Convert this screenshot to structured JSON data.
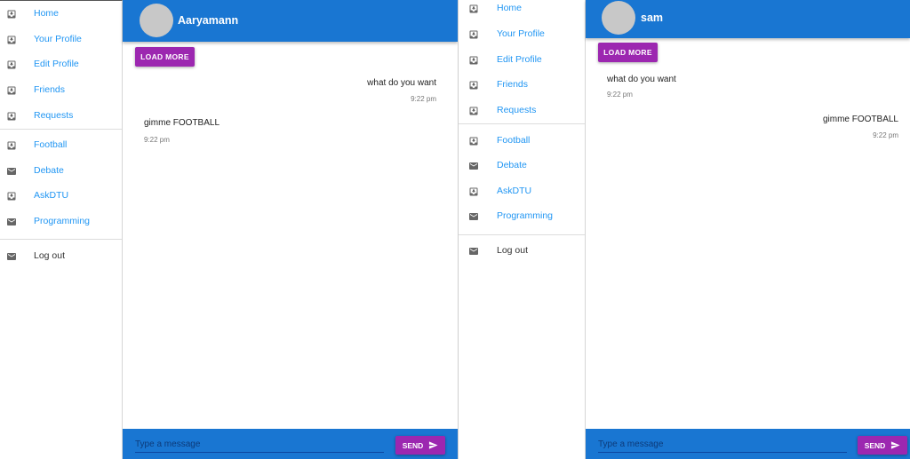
{
  "colors": {
    "appbar": "#1976d2",
    "accent": "#9c27b0",
    "link": "#2196f3",
    "avatar": "#c8c8c8"
  },
  "left": {
    "nav": {
      "items": [
        {
          "label": "Home",
          "icon": "inbox-icon"
        },
        {
          "label": "Your Profile",
          "icon": "inbox-icon"
        },
        {
          "label": "Edit Profile",
          "icon": "inbox-icon"
        },
        {
          "label": "Friends",
          "icon": "inbox-icon"
        },
        {
          "label": "Requests",
          "icon": "inbox-icon"
        }
      ],
      "groups": [
        {
          "label": "Football",
          "icon": "inbox-icon"
        },
        {
          "label": "Debate",
          "icon": "mail-icon"
        },
        {
          "label": "AskDTU",
          "icon": "inbox-icon"
        },
        {
          "label": "Programming",
          "icon": "mail-icon"
        }
      ],
      "logout": {
        "label": "Log out",
        "icon": "mail-icon"
      }
    },
    "chat": {
      "title": "Aaryamann",
      "load_more": "LOAD MORE",
      "messages": [
        {
          "text": "what do you want",
          "time": "9:22 pm",
          "side": "right"
        },
        {
          "text": "gimme FOOTBALL",
          "time": "9:22 pm",
          "side": "left"
        }
      ],
      "input_placeholder": "Type a message",
      "send_label": "SEND"
    }
  },
  "right": {
    "nav": {
      "items": [
        {
          "label": "Home",
          "icon": "inbox-icon"
        },
        {
          "label": "Your Profile",
          "icon": "inbox-icon"
        },
        {
          "label": "Edit Profile",
          "icon": "inbox-icon"
        },
        {
          "label": "Friends",
          "icon": "inbox-icon"
        },
        {
          "label": "Requests",
          "icon": "inbox-icon"
        }
      ],
      "groups": [
        {
          "label": "Football",
          "icon": "inbox-icon"
        },
        {
          "label": "Debate",
          "icon": "mail-icon"
        },
        {
          "label": "AskDTU",
          "icon": "inbox-icon"
        },
        {
          "label": "Programming",
          "icon": "mail-icon"
        }
      ],
      "logout": {
        "label": "Log out",
        "icon": "mail-icon"
      }
    },
    "chat": {
      "title": "sam",
      "load_more": "LOAD MORE",
      "messages": [
        {
          "text": "what do you want",
          "time": "9:22 pm",
          "side": "left"
        },
        {
          "text": "gimme FOOTBALL",
          "time": "9:22 pm",
          "side": "right"
        }
      ],
      "input_placeholder": "Type a message",
      "send_label": "SEND"
    }
  }
}
